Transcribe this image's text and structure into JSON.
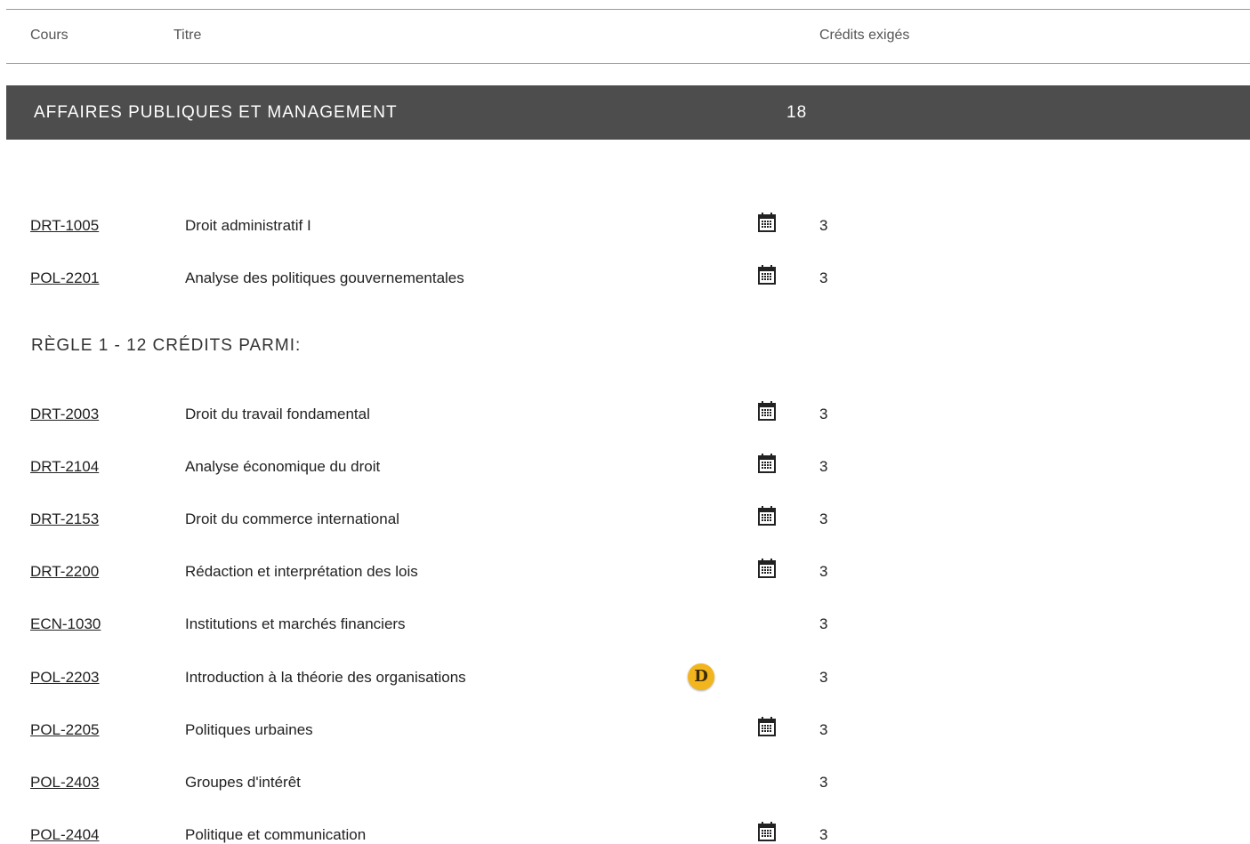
{
  "table_header": {
    "cours": "Cours",
    "titre": "Titre",
    "credits": "Crédits exigés"
  },
  "section": {
    "title": "AFFAIRES PUBLIQUES ET MANAGEMENT",
    "credits": "18"
  },
  "required_courses": [
    {
      "code": "DRT-1005",
      "title": "Droit administratif I",
      "icon": "calendar-icon",
      "credits": "3"
    },
    {
      "code": "POL-2201",
      "title": "Analyse des politiques gouvernementales",
      "icon": "calendar-icon",
      "credits": "3"
    }
  ],
  "rule": {
    "heading": "RÈGLE 1 - 12 CRÉDITS PARMI:"
  },
  "rule_courses": [
    {
      "code": "DRT-2003",
      "title": "Droit du travail fondamental",
      "icon": "calendar-icon",
      "credits": "3"
    },
    {
      "code": "DRT-2104",
      "title": "Analyse économique du droit",
      "icon": "calendar-icon",
      "credits": "3"
    },
    {
      "code": "DRT-2153",
      "title": "Droit du commerce international",
      "icon": "calendar-icon",
      "credits": "3"
    },
    {
      "code": "DRT-2200",
      "title": "Rédaction et interprétation des lois",
      "icon": "calendar-icon",
      "credits": "3"
    },
    {
      "code": "ECN-1030",
      "title": "Institutions et marchés financiers",
      "icon": "",
      "credits": "3"
    },
    {
      "code": "POL-2203",
      "title": "Introduction à la théorie des organisations",
      "icon": "distance-badge-icon",
      "badge_letter": "D",
      "credits": "3"
    },
    {
      "code": "POL-2205",
      "title": "Politiques urbaines",
      "icon": "calendar-icon",
      "credits": "3"
    },
    {
      "code": "POL-2403",
      "title": "Groupes d'intérêt",
      "icon": "",
      "credits": "3"
    },
    {
      "code": "POL-2404",
      "title": "Politique et communication",
      "icon": "calendar-icon",
      "credits": "3"
    }
  ],
  "colors": {
    "section_bar": "#4d4d4d",
    "badge": "#f2b51e",
    "rule_line": "#9a9a9a"
  }
}
